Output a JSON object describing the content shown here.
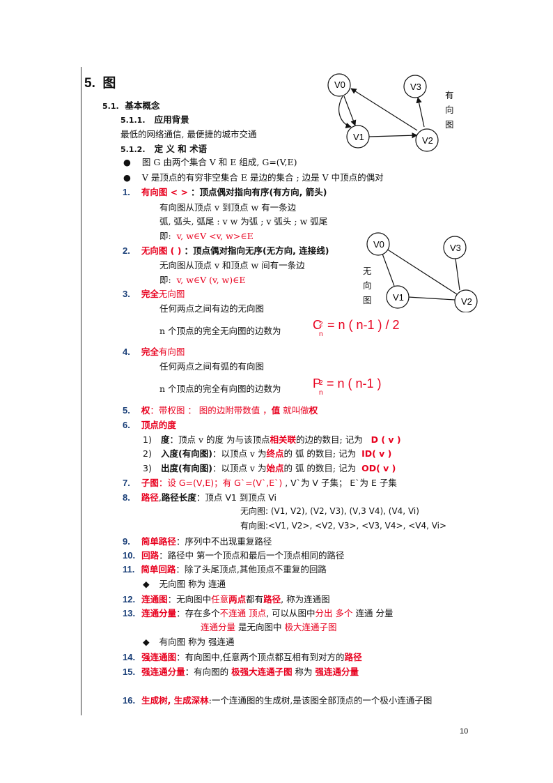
{
  "section": {
    "num": "5.",
    "title": "图"
  },
  "sub1": {
    "num": "5.1.",
    "title": "基本概念"
  },
  "sub11": {
    "num": "5.1.1.",
    "title": "应用背景"
  },
  "background_text": "最低的网络通信, 最便捷的城市交通",
  "sub12": {
    "num": "5.1.2.",
    "title": "定 义 和 术语"
  },
  "bullet1": "图 G 由两个集合 V 和 E 组成, G=(V,E)",
  "bullet2": "V 是顶点的有穷非空集合    E 是边的集合   ;    边是 V 中顶点的偶对",
  "item1": {
    "num": "1.",
    "title": "有向图 < >",
    "desc": "：顶点偶对指向有序(有方向, 箭头)",
    "line1": "有向图从顶点 v 到顶点 w 有一条边",
    "line2": "弧, 弧头, 弧尾  :   v w 为弧 ;    v  弧头 ;    w  弧尾",
    "line3a": "即:",
    "line3b": "v, w∈V    <v, w>∈E"
  },
  "item2": {
    "num": "2.",
    "title": "无向图 ( )",
    "desc": "：顶点偶对指向无序(无方向, 连接线)",
    "line1": "无向图从顶点 v 和顶点 w 间有一条边",
    "line2a": "即:",
    "line2b": "v, w∈V    (v, w)∈E"
  },
  "item3": {
    "num": "3.",
    "title_a": "完全",
    "title_b": "无向图",
    "line1": "任何两点之间有边的无向图",
    "count_text": "n 个顶点的完全无向图的边数为"
  },
  "item4": {
    "num": "4.",
    "title_a": "完全",
    "title_b": "有向图",
    "line1": "任何两点之间有弧的有向图",
    "count_text": "n 个顶点的完全有向图的边数为"
  },
  "formula_c": {
    "base": "C",
    "sup": "2",
    "sub": "n",
    "rest": "= n ( n-1 ) / 2"
  },
  "formula_p": {
    "base": "P",
    "sup": "2",
    "sub": "n",
    "rest": "= n ( n-1 )"
  },
  "item5": {
    "num": "5.",
    "a": "权",
    "b": "：带权图 ：  图的边附带数值 ，",
    "c": "值",
    "d": " 就叫做",
    "e": "权"
  },
  "item6": {
    "num": "6.",
    "title": "顶点的度",
    "d1": {
      "n": "1)",
      "a": "度",
      "b": "：顶点 v 的度  为与该顶点",
      "c": "相关联",
      "d": "的边的数目;  记为",
      "e": "D ( v )"
    },
    "d2": {
      "n": "2)",
      "a": "入度(有向图)",
      "b": "：以顶点 v 为",
      "c": "终点",
      "d": "的  弧  的数目;  记为",
      "e": "ID( v )"
    },
    "d3": {
      "n": "3)",
      "a": "出度(有向图)",
      "b": "：以顶点 v 为",
      "c": "始点",
      "d": "的  弧  的数目;  记为",
      "e": "OD( v )"
    }
  },
  "item7": {
    "num": "7.",
    "a": "子图",
    "b": "：设 G=(V,E)；",
    "c": "有 G`=(V`,E`)",
    "d": " , V`为 V 子集；   E`为 E 子集"
  },
  "item8": {
    "num": "8.",
    "a": "路径",
    "b": ",",
    "c": "路径长度",
    "d": "：顶点 V1 到顶点 Vi",
    "l1": "无向图: (V1, V2), (V2, V3), (V,3 V4), (V4, Vi)",
    "l2": "有向图:<V1, V2>, <V2, V3>, <V3, V4>, <V4, Vi>"
  },
  "item9": {
    "num": "9.",
    "a": "简单路径",
    "b": "：序列中不出现重复路径"
  },
  "item10": {
    "num": "10.",
    "a": "回路",
    "b": "：路径中  第一个顶点和最后一个顶点相同的路径"
  },
  "item11": {
    "num": "11.",
    "a": "简单回路",
    "b": "：除了头尾顶点,其他顶点不重复的回路"
  },
  "diamond1": "无向图  称为  连通",
  "item12": {
    "num": "12.",
    "a": "连通图",
    "b": "：无向图中",
    "c": "任意",
    "d": "两点",
    "e": "都有",
    "f": "路径",
    "g": ", 称为连通图"
  },
  "item13": {
    "num": "13.",
    "a": "连通分量",
    "b": "：存在多个",
    "c": "不连通  顶点",
    "d": ", 可以从图中",
    "e": "分出 多个",
    "f": "  连通 分量",
    "l2a": "连通分量",
    "l2b": "  是无向图中  ",
    "l2c": "极大连通子图"
  },
  "diamond2": "有向图  称为  强连通",
  "item14": {
    "num": "14.",
    "a": "强连通图",
    "b": "：有向图中,任意两个顶点都互相有到对方的",
    "c": "路径"
  },
  "item15": {
    "num": "15.",
    "a": "强连通分量",
    "b": "：有向图的  ",
    "c": "极强大连通子图",
    "d": "  称为  ",
    "e": "强连通分量"
  },
  "item16": {
    "num": "16.",
    "a": "生成树, 生成深林",
    "b": ":一个连通图的生成树,是该图全部顶点的一个极小连通子图"
  },
  "diagram1": {
    "label": [
      "有",
      "向",
      "图"
    ],
    "nodes": [
      "V0",
      "V1",
      "V2",
      "V3"
    ]
  },
  "diagram2": {
    "label": [
      "无",
      "向",
      "图"
    ],
    "nodes": [
      "V0",
      "V1",
      "V2",
      "V3"
    ]
  },
  "page_number": "10"
}
